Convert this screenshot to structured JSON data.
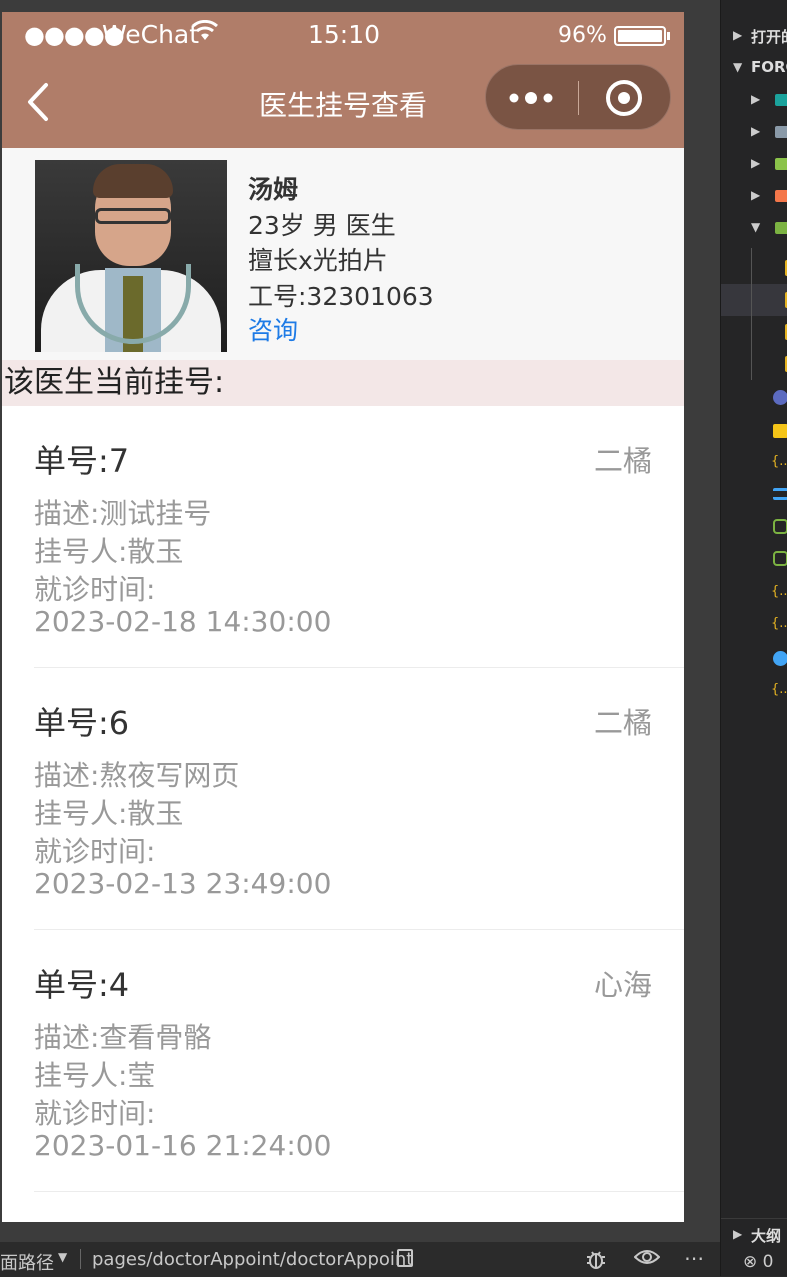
{
  "status_bar": {
    "signal": "●●●●●",
    "carrier": "WeChat",
    "wifi_icon": "wifi-icon",
    "time": "15:10",
    "battery_percent": "96%",
    "battery_level": 0.96
  },
  "nav": {
    "title": "医生挂号查看",
    "more_glyph": "•••"
  },
  "doctor": {
    "name": "汤姆",
    "info": "23岁 男 医生",
    "specialty": "擅长x光拍片",
    "staff_id": "工号:32301063",
    "consult_link": "咨询"
  },
  "section_title": "该医生当前挂号:",
  "appointments": [
    {
      "number": "单号:7",
      "doctor": "二橘",
      "description": "描述:测试挂号",
      "patient": "挂号人:散玉",
      "time_label": "就诊时间:",
      "time": "2023-02-18 14:30:00"
    },
    {
      "number": "单号:6",
      "doctor": "二橘",
      "description": "描述:熬夜写网页",
      "patient": "挂号人:散玉",
      "time_label": "就诊时间:",
      "time": "2023-02-13 23:49:00"
    },
    {
      "number": "单号:4",
      "doctor": "心海",
      "description": "描述:查看骨骼",
      "patient": "挂号人:莹",
      "time_label": "就诊时间:",
      "time": "2023-01-16 21:24:00"
    }
  ],
  "bottom_bar": {
    "path_label": "面路径",
    "path": "pages/doctorAppoint/doctorAppoint"
  },
  "sidebar": {
    "open_editors": "打开的",
    "folder": "FORC",
    "outline": "大纲",
    "errors": "⊗ 0"
  }
}
